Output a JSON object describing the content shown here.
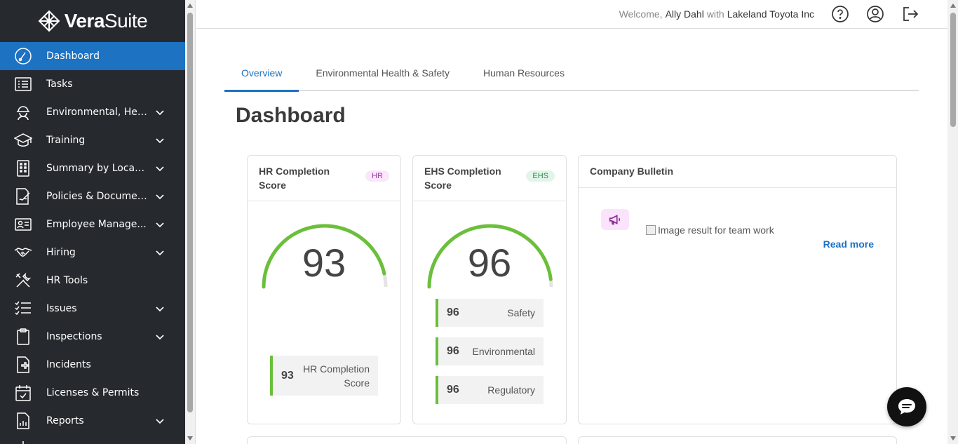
{
  "brand": {
    "name_bold": "Vera",
    "name_light": "Suite"
  },
  "sidebar": {
    "items": [
      {
        "label": "Dashboard",
        "icon": "dashboard-icon",
        "active": true,
        "expandable": false
      },
      {
        "label": "Tasks",
        "icon": "tasks-icon",
        "expandable": false
      },
      {
        "label": "Environmental, Hea...",
        "icon": "hardhat-icon",
        "expandable": true
      },
      {
        "label": "Training",
        "icon": "graduation-cap-icon",
        "expandable": true
      },
      {
        "label": "Summary by Location",
        "icon": "building-icon",
        "expandable": true
      },
      {
        "label": "Policies & Documents",
        "icon": "document-sign-icon",
        "expandable": true
      },
      {
        "label": "Employee Manage...",
        "icon": "id-card-icon",
        "expandable": true
      },
      {
        "label": "Hiring",
        "icon": "handshake-icon",
        "expandable": true
      },
      {
        "label": "HR Tools",
        "icon": "tools-icon",
        "expandable": false
      },
      {
        "label": "Issues",
        "icon": "checklist-icon",
        "expandable": true
      },
      {
        "label": "Inspections",
        "icon": "clipboard-icon",
        "expandable": true
      },
      {
        "label": "Incidents",
        "icon": "medical-file-icon",
        "expandable": false
      },
      {
        "label": "Licenses & Permits",
        "icon": "calendar-check-icon",
        "expandable": false
      },
      {
        "label": "Reports",
        "icon": "report-icon",
        "expandable": true
      }
    ]
  },
  "topbar": {
    "welcome": "Welcome,",
    "user": "Ally Dahl",
    "with": "with",
    "company": "Lakeland Toyota Inc"
  },
  "tabs": [
    "Overview",
    "Environmental Health & Safety",
    "Human Resources"
  ],
  "page_title": "Dashboard",
  "hr_card": {
    "title": "HR Completion Score",
    "badge": "HR",
    "score": "93",
    "score_fraction": 0.93,
    "metric_value": "93",
    "metric_label": "HR Completion Score"
  },
  "ehs_card": {
    "title": "EHS Completion Score",
    "badge": "EHS",
    "score": "96",
    "score_fraction": 0.96,
    "metrics": [
      {
        "value": "96",
        "label": "Safety"
      },
      {
        "value": "96",
        "label": "Environmental"
      },
      {
        "value": "96",
        "label": "Regulatory"
      }
    ]
  },
  "bulletin": {
    "title": "Company Bulletin",
    "image_alt": "Image result for team work",
    "read_more": "Read more"
  },
  "colors": {
    "accent": "#1d72c2",
    "sidebar_bg": "#262a2f",
    "gauge_green": "#6bbf3b"
  }
}
